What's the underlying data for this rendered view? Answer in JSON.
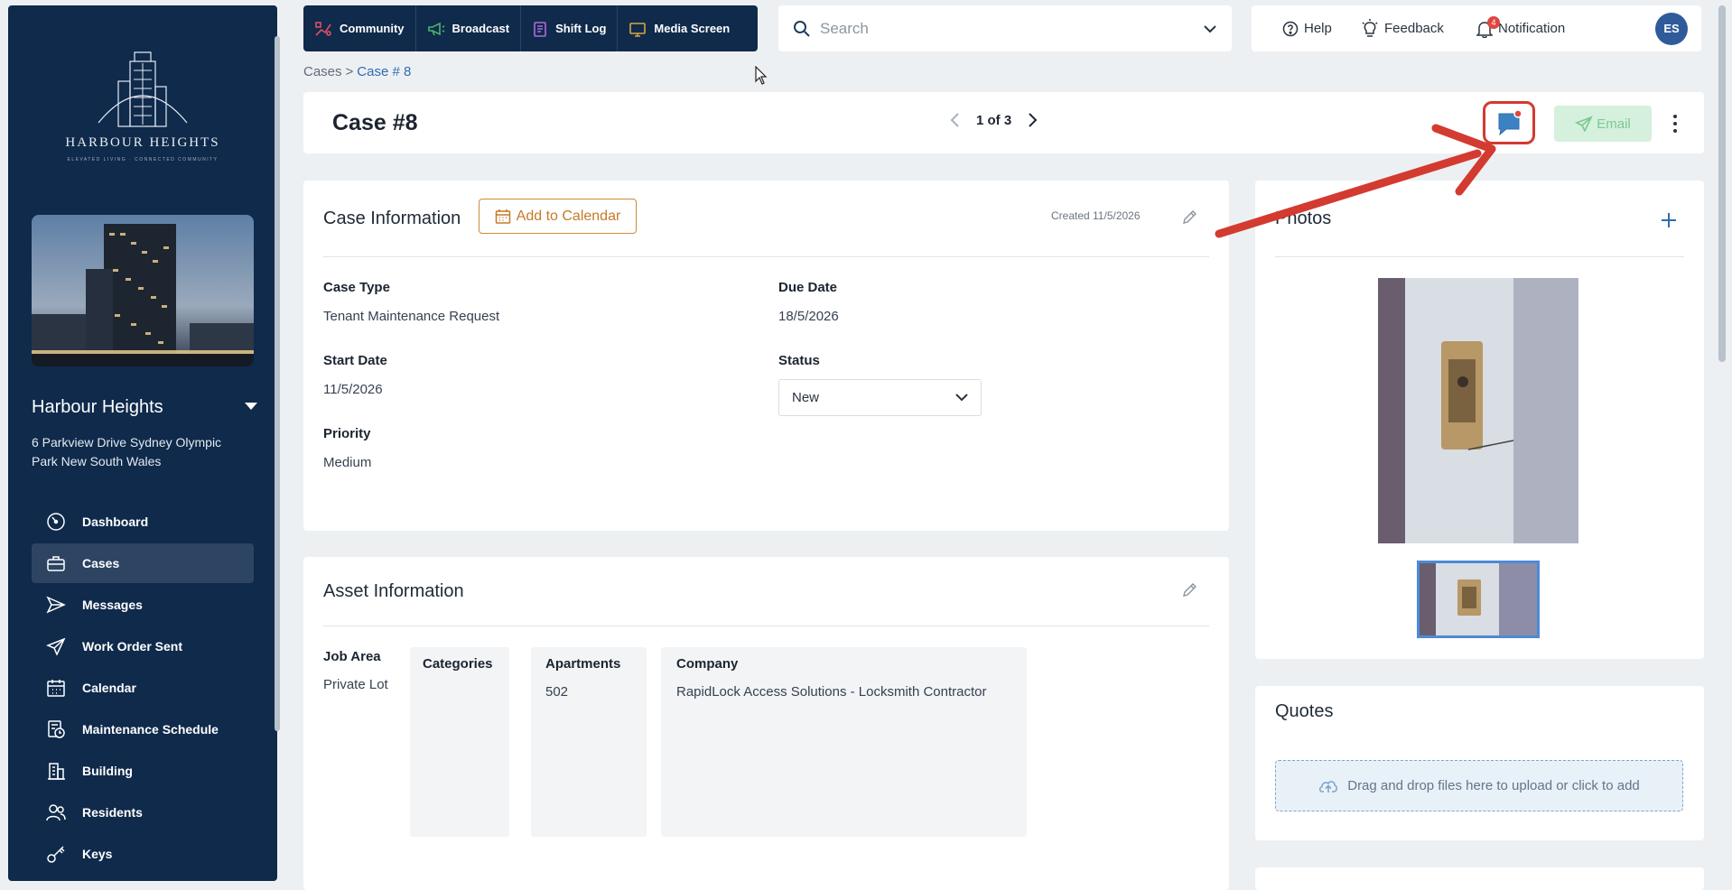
{
  "app": {
    "brand_title": "HARBOUR HEIGHTS",
    "brand_tagline": "ELEVATED LIVING · CONNECTED COMMUNITY"
  },
  "sidebar": {
    "building_name": "Harbour Heights",
    "building_address": "6 Parkview Drive Sydney Olympic Park New South Wales",
    "items": [
      {
        "label": "Dashboard",
        "icon": "dashboard-icon",
        "active": false
      },
      {
        "label": "Cases",
        "icon": "briefcase-icon",
        "active": true
      },
      {
        "label": "Messages",
        "icon": "send-icon",
        "active": false
      },
      {
        "label": "Work Order Sent",
        "icon": "paper-plane-icon",
        "active": false
      },
      {
        "label": "Calendar",
        "icon": "calendar-icon",
        "active": false
      },
      {
        "label": "Maintenance Schedule",
        "icon": "schedule-icon",
        "active": false
      },
      {
        "label": "Building",
        "icon": "building-icon",
        "active": false
      },
      {
        "label": "Residents",
        "icon": "residents-icon",
        "active": false
      },
      {
        "label": "Keys",
        "icon": "key-icon",
        "active": false
      }
    ]
  },
  "topbar": {
    "quick_links": [
      {
        "label": "Community",
        "icon": "community-icon"
      },
      {
        "label": "Broadcast",
        "icon": "megaphone-icon"
      },
      {
        "label": "Shift Log",
        "icon": "log-icon"
      },
      {
        "label": "Media Screen",
        "icon": "screen-icon"
      }
    ],
    "search_placeholder": "Search",
    "help_label": "Help",
    "feedback_label": "Feedback",
    "notification_label": "Notification",
    "notification_count": "4",
    "avatar_initials": "ES"
  },
  "breadcrumb": {
    "root": "Cases",
    "separator": ">",
    "current": "Case # 8"
  },
  "case": {
    "title": "Case #8",
    "pager": "1 of 3",
    "email_label": "Email"
  },
  "case_info": {
    "heading": "Case Information",
    "add_to_calendar": "Add to Calendar",
    "created": "Created 11/5/2026",
    "case_type_label": "Case Type",
    "case_type": "Tenant Maintenance Request",
    "due_date_label": "Due Date",
    "due_date": "18/5/2026",
    "start_date_label": "Start Date",
    "start_date": "11/5/2026",
    "status_label": "Status",
    "status": "New",
    "priority_label": "Priority",
    "priority": "Medium"
  },
  "asset_info": {
    "heading": "Asset Information",
    "job_area_label": "Job Area",
    "job_area": "Private Lot",
    "categories_label": "Categories",
    "apartments_label": "Apartments",
    "apartments": "502",
    "company_label": "Company",
    "company": "RapidLock Access Solutions - Locksmith Contractor"
  },
  "photos": {
    "heading": "Photos"
  },
  "quotes": {
    "heading": "Quotes",
    "dropzone": "Drag and drop files here to upload or click to add"
  },
  "colors": {
    "sidebar_bg": "#0f2a4b",
    "accent_orange": "#c57a27",
    "link_blue": "#2f6bb5",
    "annotation_red": "#d33a30"
  }
}
